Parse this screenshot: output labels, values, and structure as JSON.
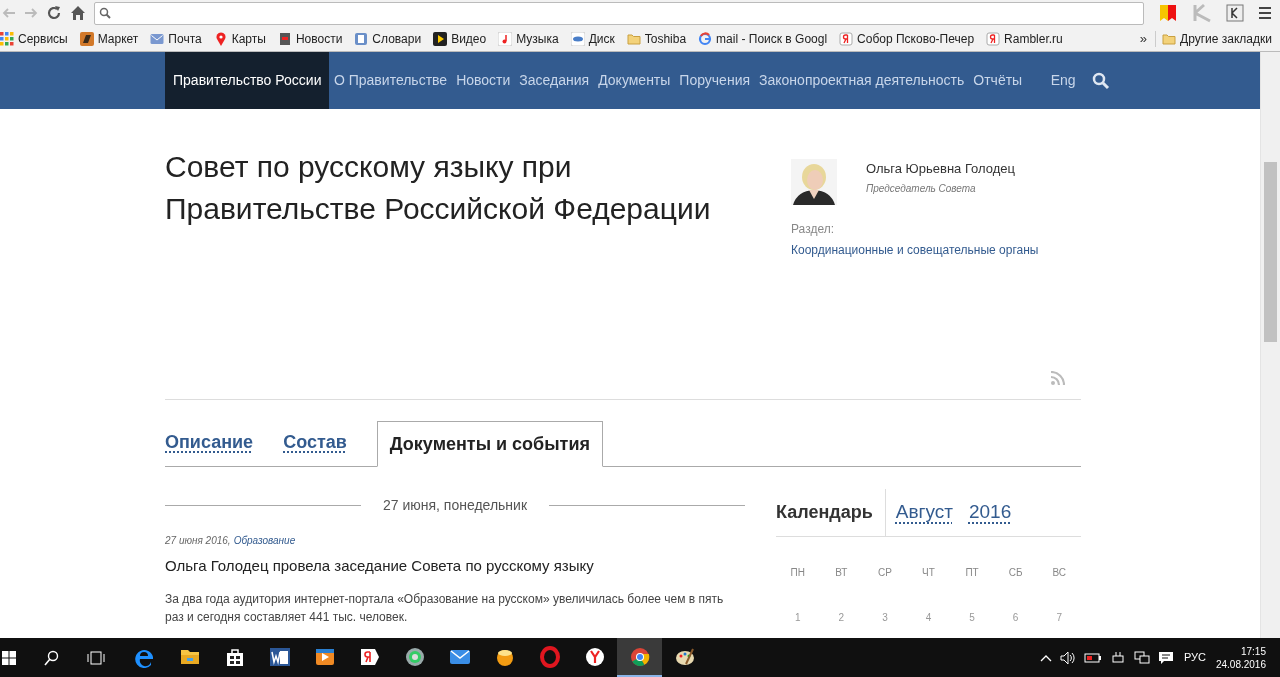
{
  "browser": {
    "bookmarks": [
      {
        "label": "Сервисы",
        "kind": "apps"
      },
      {
        "label": "Маркет",
        "kind": "market"
      },
      {
        "label": "Почта",
        "kind": "mail"
      },
      {
        "label": "Карты",
        "kind": "pin"
      },
      {
        "label": "Новости",
        "kind": "news"
      },
      {
        "label": "Словари",
        "kind": "dict"
      },
      {
        "label": "Видео",
        "kind": "video"
      },
      {
        "label": "Музыка",
        "kind": "music"
      },
      {
        "label": "Диск",
        "kind": "disk"
      },
      {
        "label": "Toshiba",
        "kind": "folder"
      },
      {
        "label": "mail - Поиск в Googl",
        "kind": "google"
      },
      {
        "label": "Собор Псково-Печер",
        "kind": "yandex"
      },
      {
        "label": "Rambler.ru",
        "kind": "yandex"
      }
    ],
    "more": "»",
    "other": "Другие закладки"
  },
  "nav": {
    "items": [
      {
        "label": "Правительство России",
        "selected": true
      },
      {
        "label": "О Правительстве",
        "selected": false
      },
      {
        "label": "Новости",
        "selected": false
      },
      {
        "label": "Заседания",
        "selected": false
      },
      {
        "label": "Документы",
        "selected": false
      },
      {
        "label": "Поручения",
        "selected": false
      },
      {
        "label": "Законопроектная деятельность",
        "selected": false
      },
      {
        "label": "Отчёты",
        "selected": false
      }
    ],
    "lang": "Eng"
  },
  "page": {
    "title": "Совет по русскому языку при Правительстве Российской Федерации",
    "person": {
      "name": "Ольга Юрьевна Голодец",
      "role": "Председатель Совета"
    },
    "section_label": "Раздел:",
    "section_link": "Координационные и совещательные органы"
  },
  "tabs": [
    {
      "label": "Описание",
      "selected": false
    },
    {
      "label": "Состав",
      "selected": false
    },
    {
      "label": "Документы и события",
      "selected": true
    }
  ],
  "feed": {
    "date_header": "27 июня, понедельник",
    "items": [
      {
        "date": "27 июня 2016,",
        "category": "Образование",
        "title": "Ольга Голодец провела заседание Совета по русскому языку",
        "summary": "За два года аудитория интернет-портала «Образование на русском» увеличилась более чем в пять раз и сегодня составляет 441 тыс. человек."
      }
    ]
  },
  "calendar": {
    "title": "Календарь",
    "month": "Август",
    "year": "2016",
    "weekdays": [
      "ПН",
      "ВТ",
      "СР",
      "ЧТ",
      "ПТ",
      "СБ",
      "ВС"
    ],
    "days": [
      "1",
      "2",
      "3",
      "4",
      "5",
      "6",
      "7"
    ]
  },
  "taskbar": {
    "apps": [
      {
        "kind": "edge",
        "selected": false
      },
      {
        "kind": "folder",
        "selected": false
      },
      {
        "kind": "store",
        "selected": false
      },
      {
        "kind": "word",
        "selected": false
      },
      {
        "kind": "player",
        "selected": false
      },
      {
        "kind": "yandex",
        "selected": false
      },
      {
        "kind": "disc",
        "selected": false
      },
      {
        "kind": "mail",
        "selected": false
      },
      {
        "kind": "ball",
        "selected": false
      },
      {
        "kind": "opera",
        "selected": false
      },
      {
        "kind": "yabrowser",
        "selected": false
      },
      {
        "kind": "chrome",
        "selected": true
      },
      {
        "kind": "paint",
        "selected": false
      }
    ],
    "lang": "РУС",
    "time": "17:15",
    "date": "24.08.2016"
  }
}
